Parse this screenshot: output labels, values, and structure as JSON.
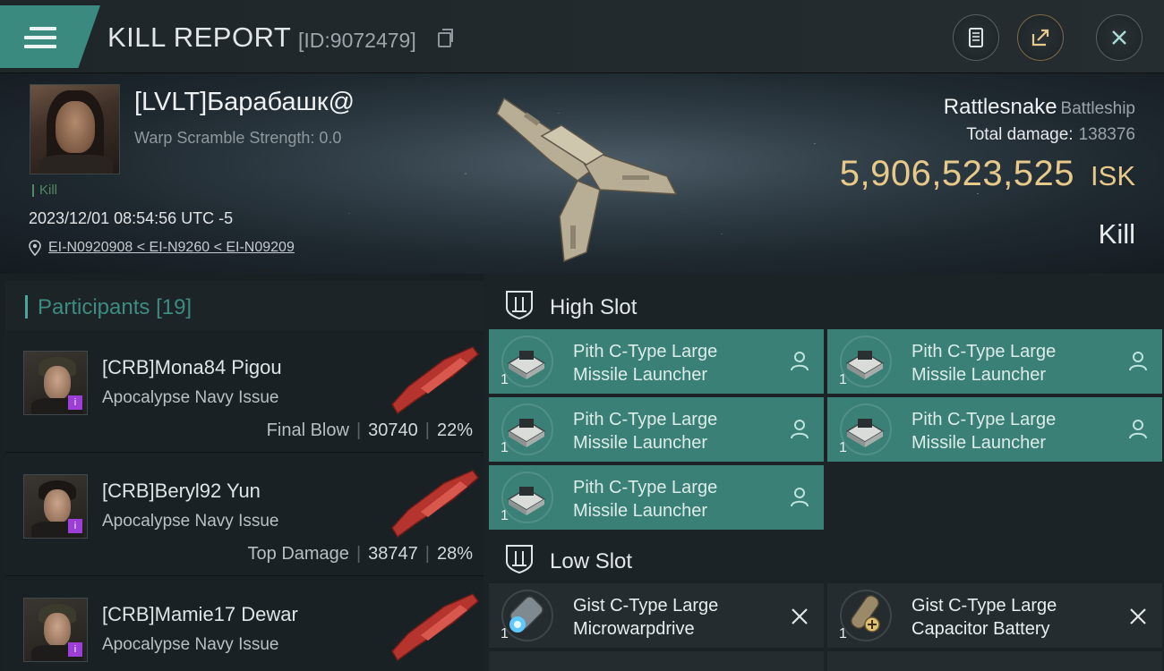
{
  "header": {
    "title": "KILL REPORT",
    "report_id": "[ID:9072479]",
    "buttons": [
      "document-icon",
      "share-icon",
      "close-icon"
    ]
  },
  "victim": {
    "name": "[LVLT]Барабашк@",
    "warp_scramble": "Warp Scramble Strength: 0.0",
    "kill_tag": "Kill",
    "datetime": "2023/12/01 08:54:56 UTC -5",
    "location": "EI-N0920908 < EI-N9260 < EI-N09209",
    "ship_name": "Rattlesnake",
    "ship_class": "Battleship",
    "total_damage_label": "Total damage:",
    "total_damage": "138376",
    "isk_value": "5,906,523,525",
    "isk_label": "ISK",
    "result": "Kill"
  },
  "participants": {
    "label": "Participants",
    "count": "[19]",
    "items": [
      {
        "name": "[CRB]Mona84 Pigou",
        "ship": "Apocalypse Navy Issue",
        "role": "Final Blow",
        "damage": "30740",
        "percent": "22%"
      },
      {
        "name": "[CRB]Beryl92 Yun",
        "ship": "Apocalypse Navy Issue",
        "role": "Top Damage",
        "damage": "38747",
        "percent": "28%"
      },
      {
        "name": "[CRB]Mamie17 Dewar",
        "ship": "Apocalypse Navy Issue",
        "role": "",
        "damage": "",
        "percent": ""
      }
    ]
  },
  "fitting": {
    "high_slot": {
      "label": "High Slot",
      "items": [
        {
          "qty": "1",
          "line1": "Pith C-Type Large",
          "line2": "Missile Launcher",
          "status": "dropped"
        },
        {
          "qty": "1",
          "line1": "Pith C-Type Large",
          "line2": "Missile Launcher",
          "status": "dropped"
        },
        {
          "qty": "1",
          "line1": "Pith C-Type Large",
          "line2": "Missile Launcher",
          "status": "dropped"
        },
        {
          "qty": "1",
          "line1": "Pith C-Type Large",
          "line2": "Missile Launcher",
          "status": "dropped"
        },
        {
          "qty": "1",
          "line1": "Pith C-Type Large",
          "line2": "Missile Launcher",
          "status": "dropped"
        }
      ]
    },
    "low_slot": {
      "label": "Low Slot",
      "items": [
        {
          "qty": "1",
          "line1": "Gist C-Type Large",
          "line2": "Microwarpdrive",
          "status": "destroyed"
        },
        {
          "qty": "1",
          "line1": "Gist C-Type Large",
          "line2": "Capacitor Battery",
          "status": "destroyed"
        }
      ]
    }
  },
  "colors": {
    "accent_teal": "#3a8077",
    "isk_gold": "#e7c98a",
    "badge_purple": "#9b3fd8"
  }
}
